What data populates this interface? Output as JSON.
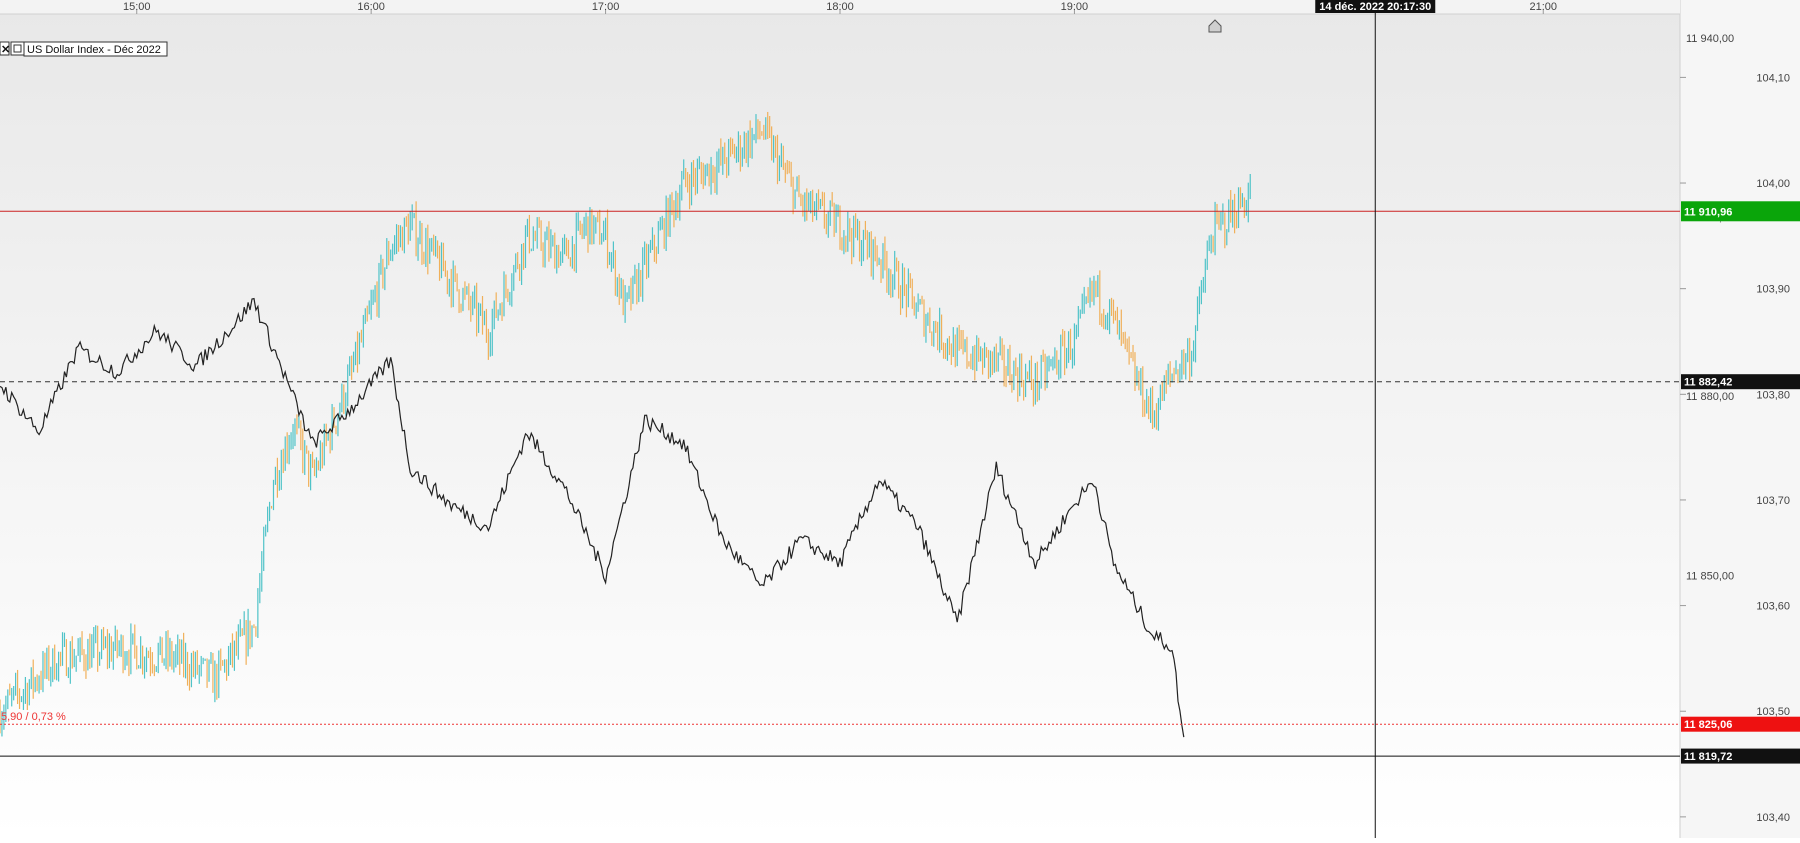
{
  "instrument": {
    "label": "US Dollar Index - Déc 2022"
  },
  "crosshair": {
    "datetime_label": "14 déc. 2022 20:17:30"
  },
  "colors": {
    "up_bar": "#4fc3c8",
    "down_bar": "#f0b05a",
    "comparison_line": "#222222",
    "last_price_badge": "#0aa50a",
    "support_badge": "#ee1111",
    "current_badge": "#111111",
    "reference_badge": "#111111",
    "resistance_line": "#cc2222",
    "support_line": "#ee3333",
    "reference_line": "#333333"
  },
  "chart_data": {
    "type": "line",
    "x_axis": {
      "ticks": [
        "15:00",
        "16:00",
        "17:00",
        "18:00",
        "19:00",
        "21:00"
      ],
      "range": [
        "14:25",
        "21:35"
      ]
    },
    "y_axis_left": {
      "name": "US Dollar Index (bars)",
      "range": [
        103.38,
        104.16
      ],
      "ticks": [
        "104,10",
        "104,00",
        "103,90",
        "103,80",
        "103,70",
        "103,60",
        "103,50",
        "103,40"
      ]
    },
    "y_axis_right": {
      "name": "comparison line",
      "range": [
        11806,
        11944
      ],
      "ticks": [
        "11 940,00",
        "11 910,00",
        "11 880,00",
        "11 850,00",
        "11 820,00"
      ]
    },
    "price_levels": [
      {
        "label": "11 910,96",
        "value": 11910.96,
        "style": "solid-red"
      },
      {
        "label": "11 882,42",
        "value": 11882.42,
        "style": "dashed-black"
      },
      {
        "label": "11 825,06",
        "value": 11825.06,
        "style": "dotted-red",
        "annotation": "5,90 / 0,73 %"
      },
      {
        "label": "11 819,72",
        "value": 11819.72,
        "style": "solid-black"
      }
    ],
    "crosshair_time": "20:17",
    "series": [
      {
        "type": "bar",
        "x": [
          "14:25",
          "14:40",
          "14:55",
          "15:10",
          "15:20",
          "15:30",
          "15:35",
          "15:40",
          "15:45",
          "15:55",
          "16:05",
          "16:10",
          "16:20",
          "16:30",
          "16:40",
          "16:50",
          "16:55",
          "17:00",
          "17:05",
          "17:10",
          "17:20",
          "17:30",
          "17:40",
          "17:50",
          "18:00",
          "18:10",
          "18:20",
          "18:30",
          "18:40",
          "18:50",
          "19:00",
          "19:05",
          "19:10",
          "19:15",
          "19:20",
          "19:25",
          "19:30",
          "19:35",
          "19:40",
          "19:45"
        ],
        "values": [
          103.5,
          103.55,
          103.56,
          103.55,
          103.53,
          103.58,
          103.72,
          103.77,
          103.72,
          103.82,
          103.94,
          103.96,
          103.91,
          103.86,
          103.95,
          103.93,
          103.96,
          103.95,
          103.88,
          103.92,
          104.0,
          104.02,
          104.05,
          103.98,
          103.96,
          103.93,
          103.88,
          103.84,
          103.83,
          103.81,
          103.85,
          103.9,
          103.87,
          103.82,
          103.78,
          103.82,
          103.84,
          103.95,
          103.97,
          103.99
        ]
      },
      {
        "type": "line",
        "x": [
          "14:25",
          "14:35",
          "14:45",
          "14:55",
          "15:05",
          "15:15",
          "15:25",
          "15:30",
          "15:35",
          "15:45",
          "15:55",
          "16:05",
          "16:10",
          "16:20",
          "16:30",
          "16:40",
          "16:50",
          "17:00",
          "17:10",
          "17:20",
          "17:30",
          "17:40",
          "17:50",
          "18:00",
          "18:10",
          "18:20",
          "18:30",
          "18:40",
          "18:50",
          "19:00",
          "19:05",
          "19:10",
          "19:15",
          "19:20",
          "19:25",
          "19:28"
        ],
        "values": [
          11882,
          11874,
          11888,
          11884,
          11891,
          11885,
          11892,
          11896,
          11888,
          11872,
          11878,
          11886,
          11868,
          11862,
          11858,
          11874,
          11864,
          11850,
          11876,
          11872,
          11856,
          11848,
          11856,
          11852,
          11866,
          11858,
          11842,
          11868,
          11852,
          11862,
          11866,
          11852,
          11846,
          11840,
          11838,
          11822
        ]
      }
    ]
  }
}
